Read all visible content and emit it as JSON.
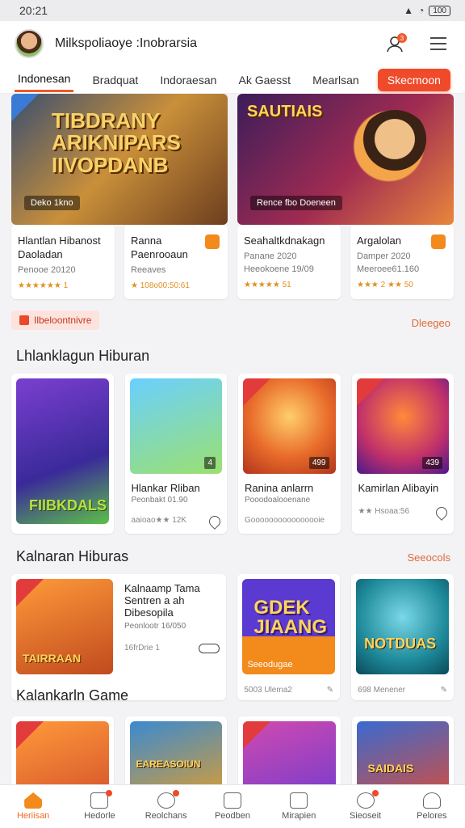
{
  "status": {
    "time": "20:21",
    "battery": "100"
  },
  "header": {
    "title": "Milkspoliaoye :Inobrarsia",
    "notif_count": "3"
  },
  "tabs": [
    "Indonesan",
    "Bradquat",
    "Indoraesan",
    "Ak Gaesst",
    "Mearlsan",
    "Skecmoon"
  ],
  "banners": [
    {
      "title": "TIBDRANY\nARIKNIPARS\nIIVOPDANB",
      "tag": "Deko 1kno"
    },
    {
      "title": "SAUTIAIS",
      "tag": "Rence fbo Doeneen"
    }
  ],
  "promo_cards": [
    {
      "title": "Hlantlan Hibanost Daoladan",
      "sub": "Penooe 20120",
      "rating": "★★★★★★ 1"
    },
    {
      "title": "Ranna Paenrooaun",
      "sub": "Reeaves",
      "rating": "★ 108o00:50:61"
    },
    {
      "title": "Seahaltkdnakagn",
      "sub": "Panane 2020",
      "extra": "Heeokoene 19/09",
      "rating": "★★★★★ 51"
    },
    {
      "title": "Argalolan",
      "sub": "Damper 2020",
      "extra": "Meeroee61.160",
      "rating": "★★★ 2 ★★ 50"
    }
  ],
  "chip": {
    "label": "Ilbeloontnivre"
  },
  "links": {
    "chip_link": "Dleegeo",
    "sec2_link": "Seeocols"
  },
  "sections": [
    {
      "title": "Lhlanklagun Hiburan",
      "games": [
        {
          "art": "FIlBKDALS",
          "title": "",
          "sub": "",
          "meta": ""
        },
        {
          "title": "Hlankar Rliban",
          "sub": "Peonbakt 01.90",
          "meta": "aaioao★★ 12K",
          "badge": "4"
        },
        {
          "title": "Ranina anlarrn",
          "sub": "Pooodoalooenane",
          "meta": "Goooooooooooooooie",
          "badge": "499"
        },
        {
          "title": "Kamirlan Alibayin",
          "sub": "",
          "meta": "★★ Hsoaa:56",
          "badge": "439"
        }
      ]
    },
    {
      "title": "Kalnaran Hiburas",
      "games": [
        {
          "art": "TAIRRAAN",
          "title": "Kalnaamp Tama Sentren a ah Dibesopila",
          "sub": "Peonlootr 16/050",
          "meta": "16frDrie 1"
        },
        {
          "art": "GDEK JIAANG",
          "foot": "Seeodugae",
          "meta": "5003 Ulema2"
        },
        {
          "art": "NOTDUAS",
          "meta": "698 Menener"
        }
      ]
    },
    {
      "title": "Kalankarln Game",
      "games": [
        {
          "art": ""
        },
        {
          "art": "EAREASOIUN"
        },
        {
          "art": ""
        },
        {
          "art": "SAIDAIS"
        }
      ]
    }
  ],
  "nav": [
    "Heriisan",
    "Hedorle",
    "Reolchans",
    "Peodben",
    "Mirapien",
    "Sieoseit",
    "Pelores"
  ],
  "colors": {
    "accent": "#ef5a2a",
    "link": "#e06a3a"
  }
}
